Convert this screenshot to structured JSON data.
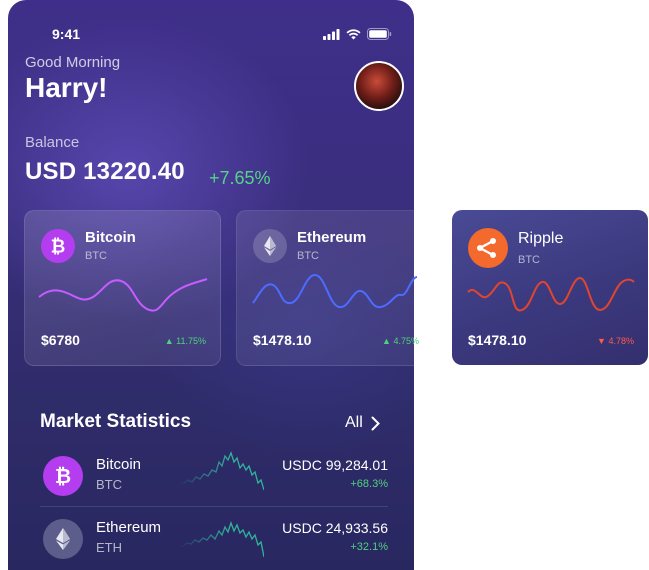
{
  "status_bar": {
    "time": "9:41"
  },
  "greeting": "Good Morning",
  "user_name": "Harry!",
  "balance": {
    "label": "Balance",
    "value": "USD 13220.40",
    "change": "+7.65%"
  },
  "cards": [
    {
      "name": "Bitcoin",
      "ticker": "BTC",
      "price": "$6780",
      "change": "11.75%",
      "direction": "up",
      "icon": "bitcoin-icon",
      "line_color": "#c65cff"
    },
    {
      "name": "Ethereum",
      "ticker": "BTC",
      "price": "$1478.10",
      "change": "4.75%",
      "direction": "up",
      "icon": "ethereum-icon",
      "line_color": "#4d6bff"
    },
    {
      "name": "Ripple",
      "ticker": "BTC",
      "price": "$1478.10",
      "change": "4.78%",
      "direction": "down",
      "icon": "ripple-icon",
      "line_color": "#e2452f"
    }
  ],
  "market": {
    "title": "Market Statistics",
    "all_label": "All",
    "rows": [
      {
        "name": "Bitcoin",
        "ticker": "BTC",
        "value": "USDC 99,284.01",
        "change": "+68.3%",
        "icon": "bitcoin-icon"
      },
      {
        "name": "Ethereum",
        "ticker": "ETH",
        "value": "USDC 24,933.56",
        "change": "+32.1%",
        "icon": "ethereum-icon"
      }
    ]
  },
  "colors": {
    "accent_positive": "#4fd17f",
    "accent_negative": "#ff5a4d",
    "bitcoin": "#b53df0",
    "ripple": "#f4692c"
  }
}
